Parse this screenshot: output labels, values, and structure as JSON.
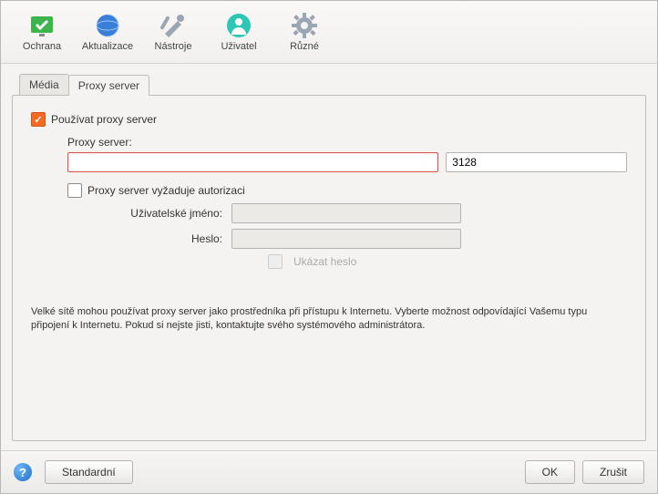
{
  "toolbar": {
    "items": [
      {
        "label": "Ochrana"
      },
      {
        "label": "Aktualizace"
      },
      {
        "label": "Nástroje"
      },
      {
        "label": "Uživatel"
      },
      {
        "label": "Různé"
      }
    ]
  },
  "tabs": [
    {
      "label": "Média",
      "active": false
    },
    {
      "label": "Proxy server",
      "active": true
    }
  ],
  "proxy": {
    "use_proxy_label": "Používat proxy server",
    "use_proxy_checked": true,
    "server_label": "Proxy server:",
    "host": "",
    "port": "3128",
    "auth_label": "Proxy server vyžaduje autorizaci",
    "auth_checked": false,
    "username_label": "Uživatelské jméno:",
    "username": "",
    "password_label": "Heslo:",
    "password": "",
    "show_password_label": "Ukázat heslo",
    "show_password_checked": false,
    "description": "Velké sítě mohou používat proxy server jako prostředníka při přístupu k Internetu. Vyberte možnost odpovídající Vašemu typu připojení k Internetu. Pokud si nejste jisti, kontaktujte svého systémového administrátora."
  },
  "footer": {
    "default": "Standardní",
    "ok": "OK",
    "cancel": "Zrušit"
  }
}
